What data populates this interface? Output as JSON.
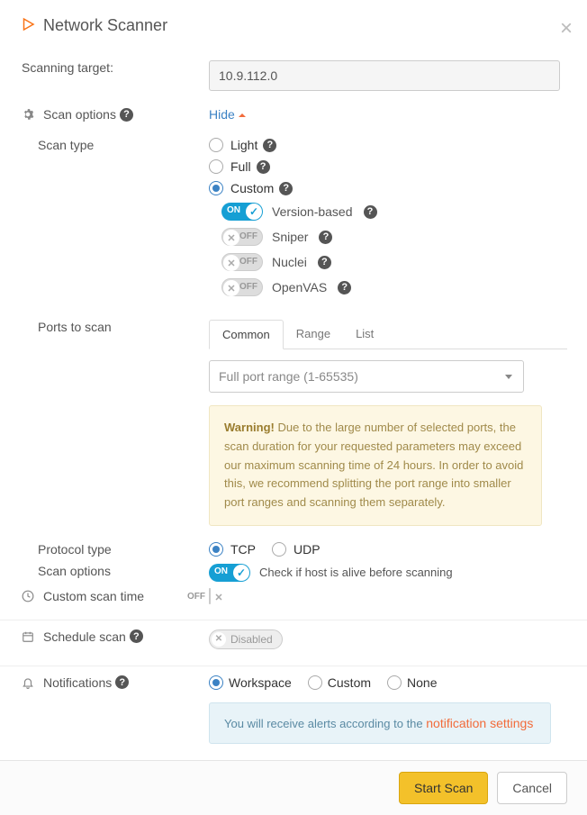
{
  "header": {
    "title": "Network Scanner"
  },
  "target": {
    "label": "Scanning target:",
    "value": "10.9.112.0"
  },
  "scan_options": {
    "label": "Scan options",
    "toggle_link": "Hide"
  },
  "scan_type": {
    "label": "Scan type",
    "options": {
      "light": "Light",
      "full": "Full",
      "custom": "Custom"
    },
    "selected": "custom",
    "custom": {
      "version_based": {
        "label": "Version-based",
        "on": true,
        "on_text": "ON"
      },
      "sniper": {
        "label": "Sniper",
        "on": false,
        "off_text": "OFF"
      },
      "nuclei": {
        "label": "Nuclei",
        "on": false,
        "off_text": "OFF"
      },
      "openvas": {
        "label": "OpenVAS",
        "on": false,
        "off_text": "OFF"
      }
    }
  },
  "ports": {
    "label": "Ports to scan",
    "tabs": {
      "common": "Common",
      "range": "Range",
      "list": "List"
    },
    "active_tab": "common",
    "select_value": "Full port range (1-65535)",
    "warning_title": "Warning!",
    "warning_body": "Due to the large number of selected ports, the scan duration for your requested parameters may exceed our maximum scanning time of 24 hours. In order to avoid this, we recommend splitting the port range into smaller port ranges and scanning them separately."
  },
  "protocol": {
    "label": "Protocol type",
    "options": {
      "tcp": "TCP",
      "udp": "UDP"
    },
    "selected": "tcp"
  },
  "scan_opts2": {
    "label": "Scan options",
    "alive_check": {
      "label": "Check if host is alive before scanning",
      "on": true,
      "on_text": "ON"
    }
  },
  "custom_time": {
    "label": "Custom scan time",
    "off_text": "OFF"
  },
  "schedule": {
    "label": "Schedule scan",
    "pill": "Disabled"
  },
  "notifications": {
    "label": "Notifications",
    "options": {
      "workspace": "Workspace",
      "custom": "Custom",
      "none": "None"
    },
    "selected": "workspace",
    "info_prefix": "You will receive alerts according to the ",
    "info_link": "notification settings"
  },
  "footer": {
    "start": "Start Scan",
    "cancel": "Cancel"
  }
}
